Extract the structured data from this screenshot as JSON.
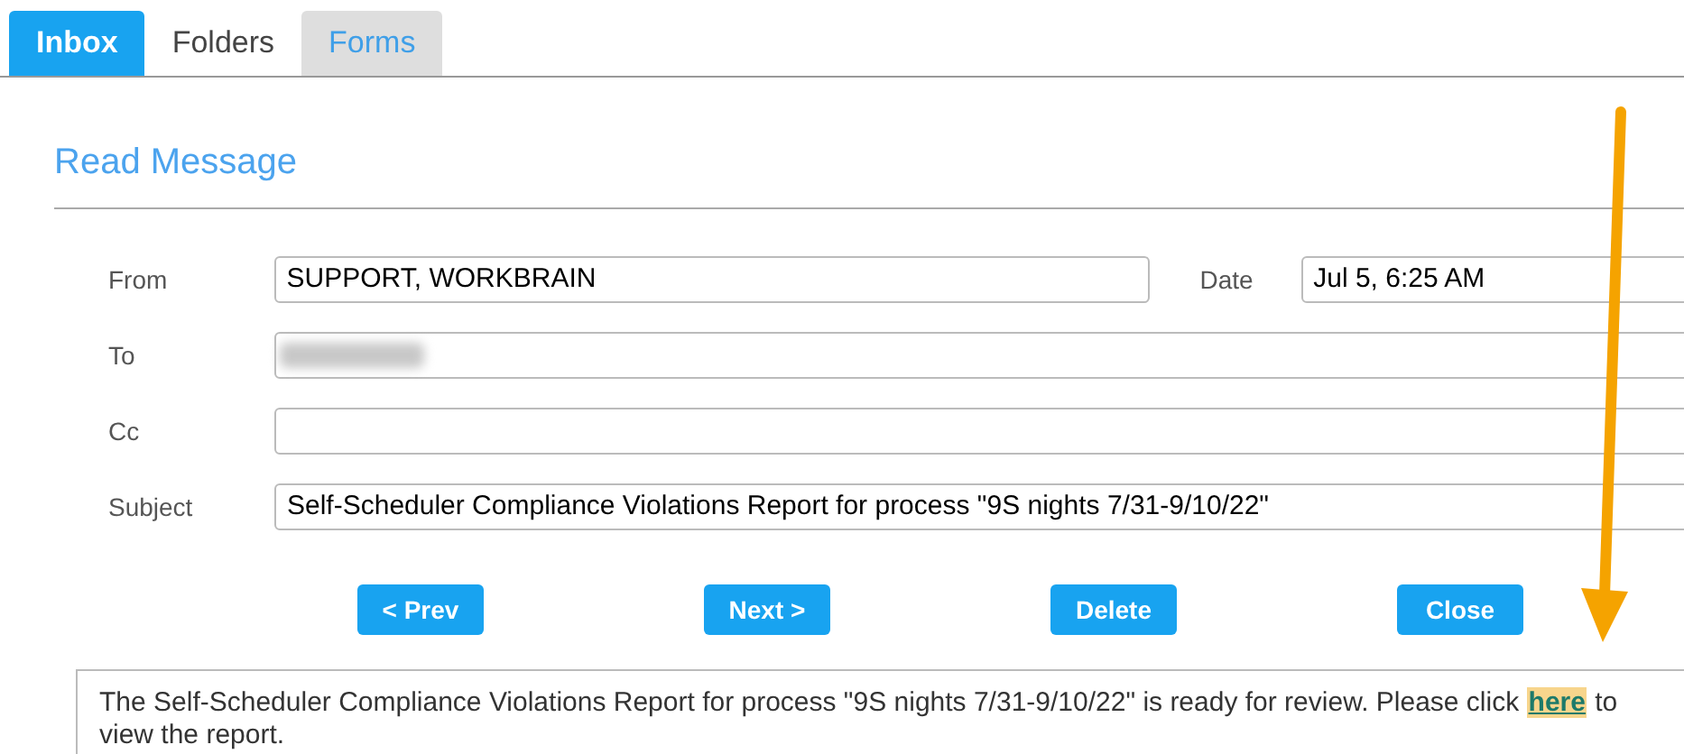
{
  "tabs": [
    {
      "label": "Inbox",
      "selected": true,
      "highlighted": false
    },
    {
      "label": "Folders",
      "selected": false,
      "highlighted": false
    },
    {
      "label": "Forms",
      "selected": false,
      "highlighted": true
    }
  ],
  "title": "Read Message",
  "fields": [
    {
      "label": "From",
      "value": "SUPPORT, WORKBRAIN",
      "kind": "text"
    },
    {
      "label": "To",
      "kind": "redacted"
    },
    {
      "label": "Cc",
      "kind": "text"
    },
    {
      "label": "Subject",
      "value": "Self-Scheduler Compliance Violations Report for process \"9S nights 7/31-9/10/22\"",
      "kind": "text"
    }
  ],
  "date": {
    "label": "Date",
    "value": "Jul 5, 6:25 AM"
  },
  "buttons": [
    "< Prev",
    "Next >",
    "Delete",
    "Close"
  ],
  "message": {
    "text_before": "The Self-Scheduler Compliance Violations Report for process \"9S nights 7/31-9/10/22\" is ready for review. Please click ",
    "link": {
      "label": "here",
      "highlighted": true
    },
    "text_after": " to view the report."
  }
}
